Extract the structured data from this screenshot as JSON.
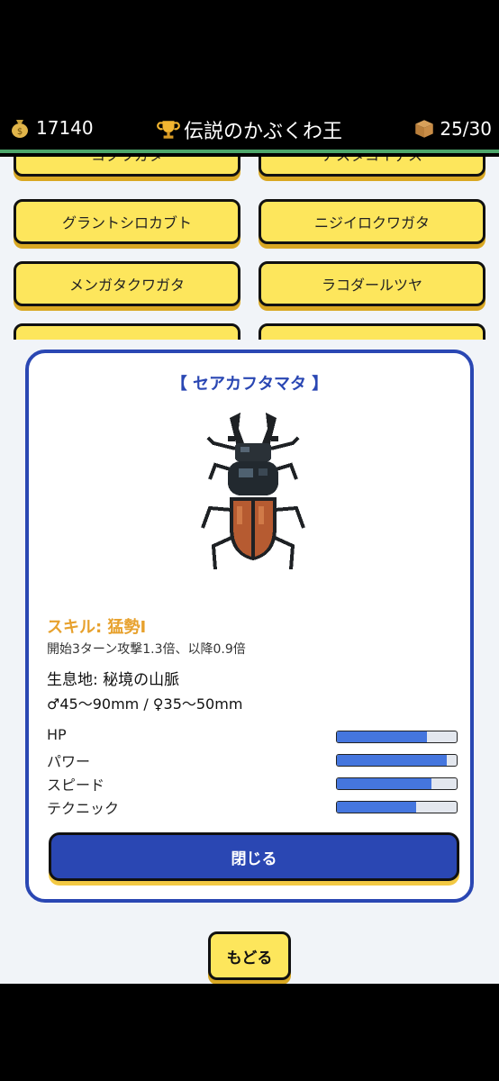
{
  "header": {
    "coins": "17140",
    "title": "伝説のかぶくわ王",
    "capacity": "25/30"
  },
  "beetle_list": [
    {
      "label": "コクワガタ"
    },
    {
      "label": "アスタコイデス"
    },
    {
      "label": "グラントシロカブト"
    },
    {
      "label": "ニジイロクワガタ"
    },
    {
      "label": "メンガタクワガタ"
    },
    {
      "label": "ラコダールツヤ"
    }
  ],
  "modal": {
    "title": "【 セアカフタマタ 】",
    "skill_name": "スキル: 猛勢Ⅰ",
    "skill_desc": "開始3ターン攻撃1.3倍、以降0.9倍",
    "habitat": "生息地: 秘境の山脈",
    "size": "♂45〜90mm / ♀35〜50mm",
    "stats": [
      {
        "label": "HP",
        "value": 0.75
      },
      {
        "label": "パワー",
        "value": 0.92
      },
      {
        "label": "スピード",
        "value": 0.79
      },
      {
        "label": "テクニック",
        "value": 0.66
      }
    ],
    "close_label": "閉じる"
  },
  "back_label": "もどる",
  "colors": {
    "accent_blue": "#2a47b3",
    "button_yellow": "#fde65c",
    "skill_orange": "#e7a12d",
    "bar_blue": "#4576de"
  }
}
